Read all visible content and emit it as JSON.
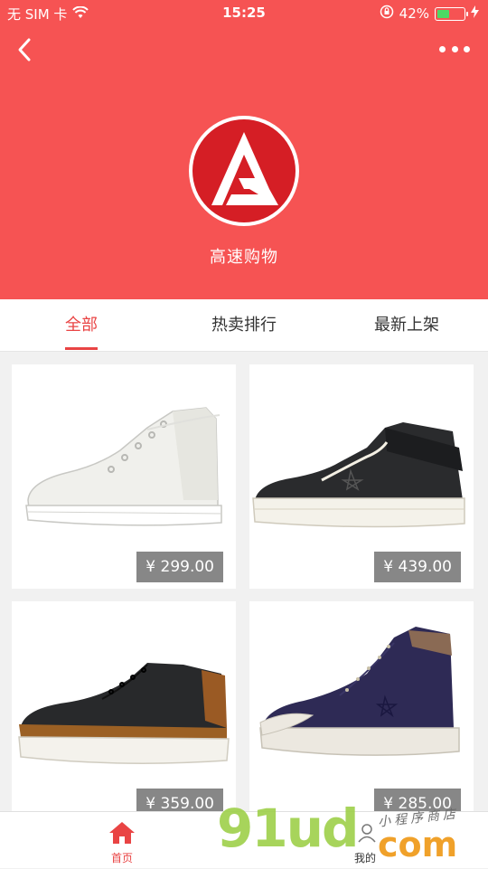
{
  "status_bar": {
    "carrier": "无 SIM 卡",
    "time": "15:25",
    "battery_percent": "42%",
    "battery_level": 0.42,
    "icons": [
      "wifi-icon",
      "orientation-lock-icon",
      "battery-icon",
      "charging-icon"
    ]
  },
  "header": {
    "background_color": "#f65353",
    "shop_name": "高速购物",
    "logo_icon": "shop-logo-g-icon",
    "back_icon": "back-chevron-icon",
    "more_icon": "more-dots-icon"
  },
  "tabs": [
    {
      "label": "全部",
      "active": true
    },
    {
      "label": "热卖排行",
      "active": false
    },
    {
      "label": "最新上架",
      "active": false
    }
  ],
  "accent_color": "#e94444",
  "products": [
    {
      "price": "¥ 299.00",
      "image": "white-high-top-sneaker"
    },
    {
      "price": "¥ 439.00",
      "image": "black-strap-high-top-sneaker"
    },
    {
      "price": "¥ 359.00",
      "image": "black-leather-sneaker"
    },
    {
      "price": "¥ 285.00",
      "image": "navy-suede-high-top-sneaker"
    }
  ],
  "tab_bar": [
    {
      "label": "首页",
      "icon": "home-icon",
      "active": true
    },
    {
      "label": "我的",
      "icon": "user-icon",
      "active": false
    }
  ],
  "watermark": {
    "brand": "91ud",
    "domain": "com",
    "tagline": "小程序商店"
  }
}
